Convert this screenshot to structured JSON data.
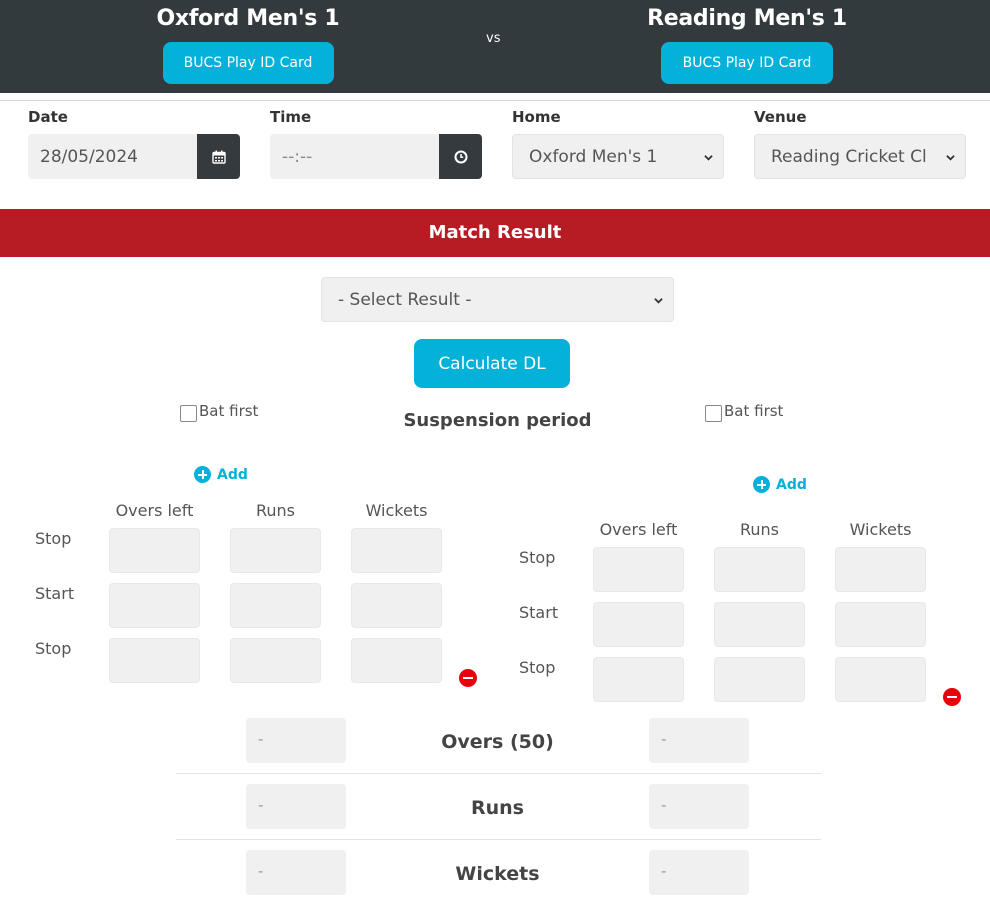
{
  "header": {
    "home_team": "Oxford Men's 1",
    "away_team": "Reading Men's 1",
    "vs": "vs",
    "play_id_label": "BUCS Play ID Card"
  },
  "fields": {
    "date_label": "Date",
    "date_value": "28/05/2024",
    "time_label": "Time",
    "time_value": "--:--",
    "home_label": "Home",
    "home_value": "Oxford Men's 1",
    "venue_label": "Venue",
    "venue_value": "Reading Cricket Cl"
  },
  "match_result": {
    "title": "Match Result",
    "select_placeholder": "- Select Result -",
    "calculate_label": "Calculate DL"
  },
  "suspension": {
    "title": "Suspension period",
    "bat_first_label": "Bat first",
    "add_label": "Add",
    "columns": [
      "Overs left",
      "Runs",
      "Wickets"
    ],
    "rows": [
      "Stop",
      "Start",
      "Stop"
    ]
  },
  "summary": {
    "rows": [
      "Overs (50)",
      "Runs",
      "Wickets"
    ],
    "placeholder": "-"
  },
  "colors": {
    "header_bg": "#333a3e",
    "accent": "#03b1d9",
    "result_bar": "#b71c24",
    "remove": "#e8000b"
  }
}
